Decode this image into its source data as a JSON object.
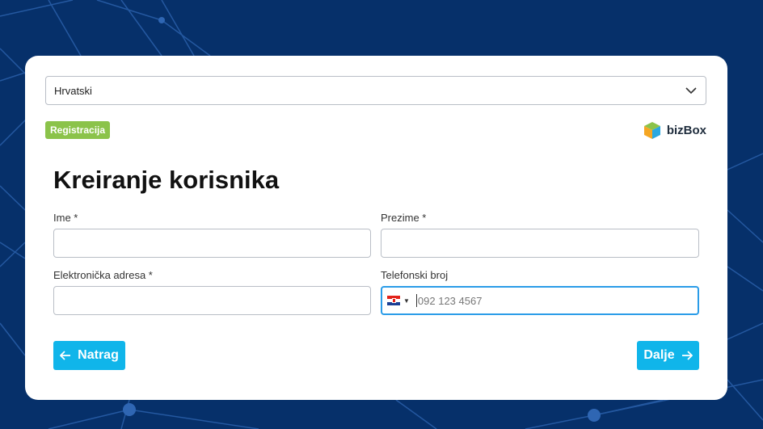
{
  "language_select": {
    "value": "Hrvatski",
    "icon": "chevron-down-icon"
  },
  "badge": {
    "label": "Registracija",
    "color": "#8bc34a"
  },
  "logo": {
    "text": "bizBox",
    "icon": "cube-logo-icon"
  },
  "form": {
    "title": "Kreiranje korisnika",
    "first_name": {
      "label": "Ime *",
      "value": ""
    },
    "last_name": {
      "label": "Prezime *",
      "value": ""
    },
    "email": {
      "label": "Elektronička adresa *",
      "value": ""
    },
    "phone": {
      "label": "Telefonski broj",
      "placeholder": "092 123 4567",
      "country": "HR",
      "country_icon": "croatia-flag-icon"
    }
  },
  "buttons": {
    "back": {
      "label": "Natrag",
      "icon": "arrow-left-icon"
    },
    "next": {
      "label": "Dalje",
      "icon": "arrow-right-icon"
    }
  },
  "colors": {
    "background": "#06306a",
    "accent": "#10b5ea",
    "focus_border": "#2a9ce8"
  }
}
